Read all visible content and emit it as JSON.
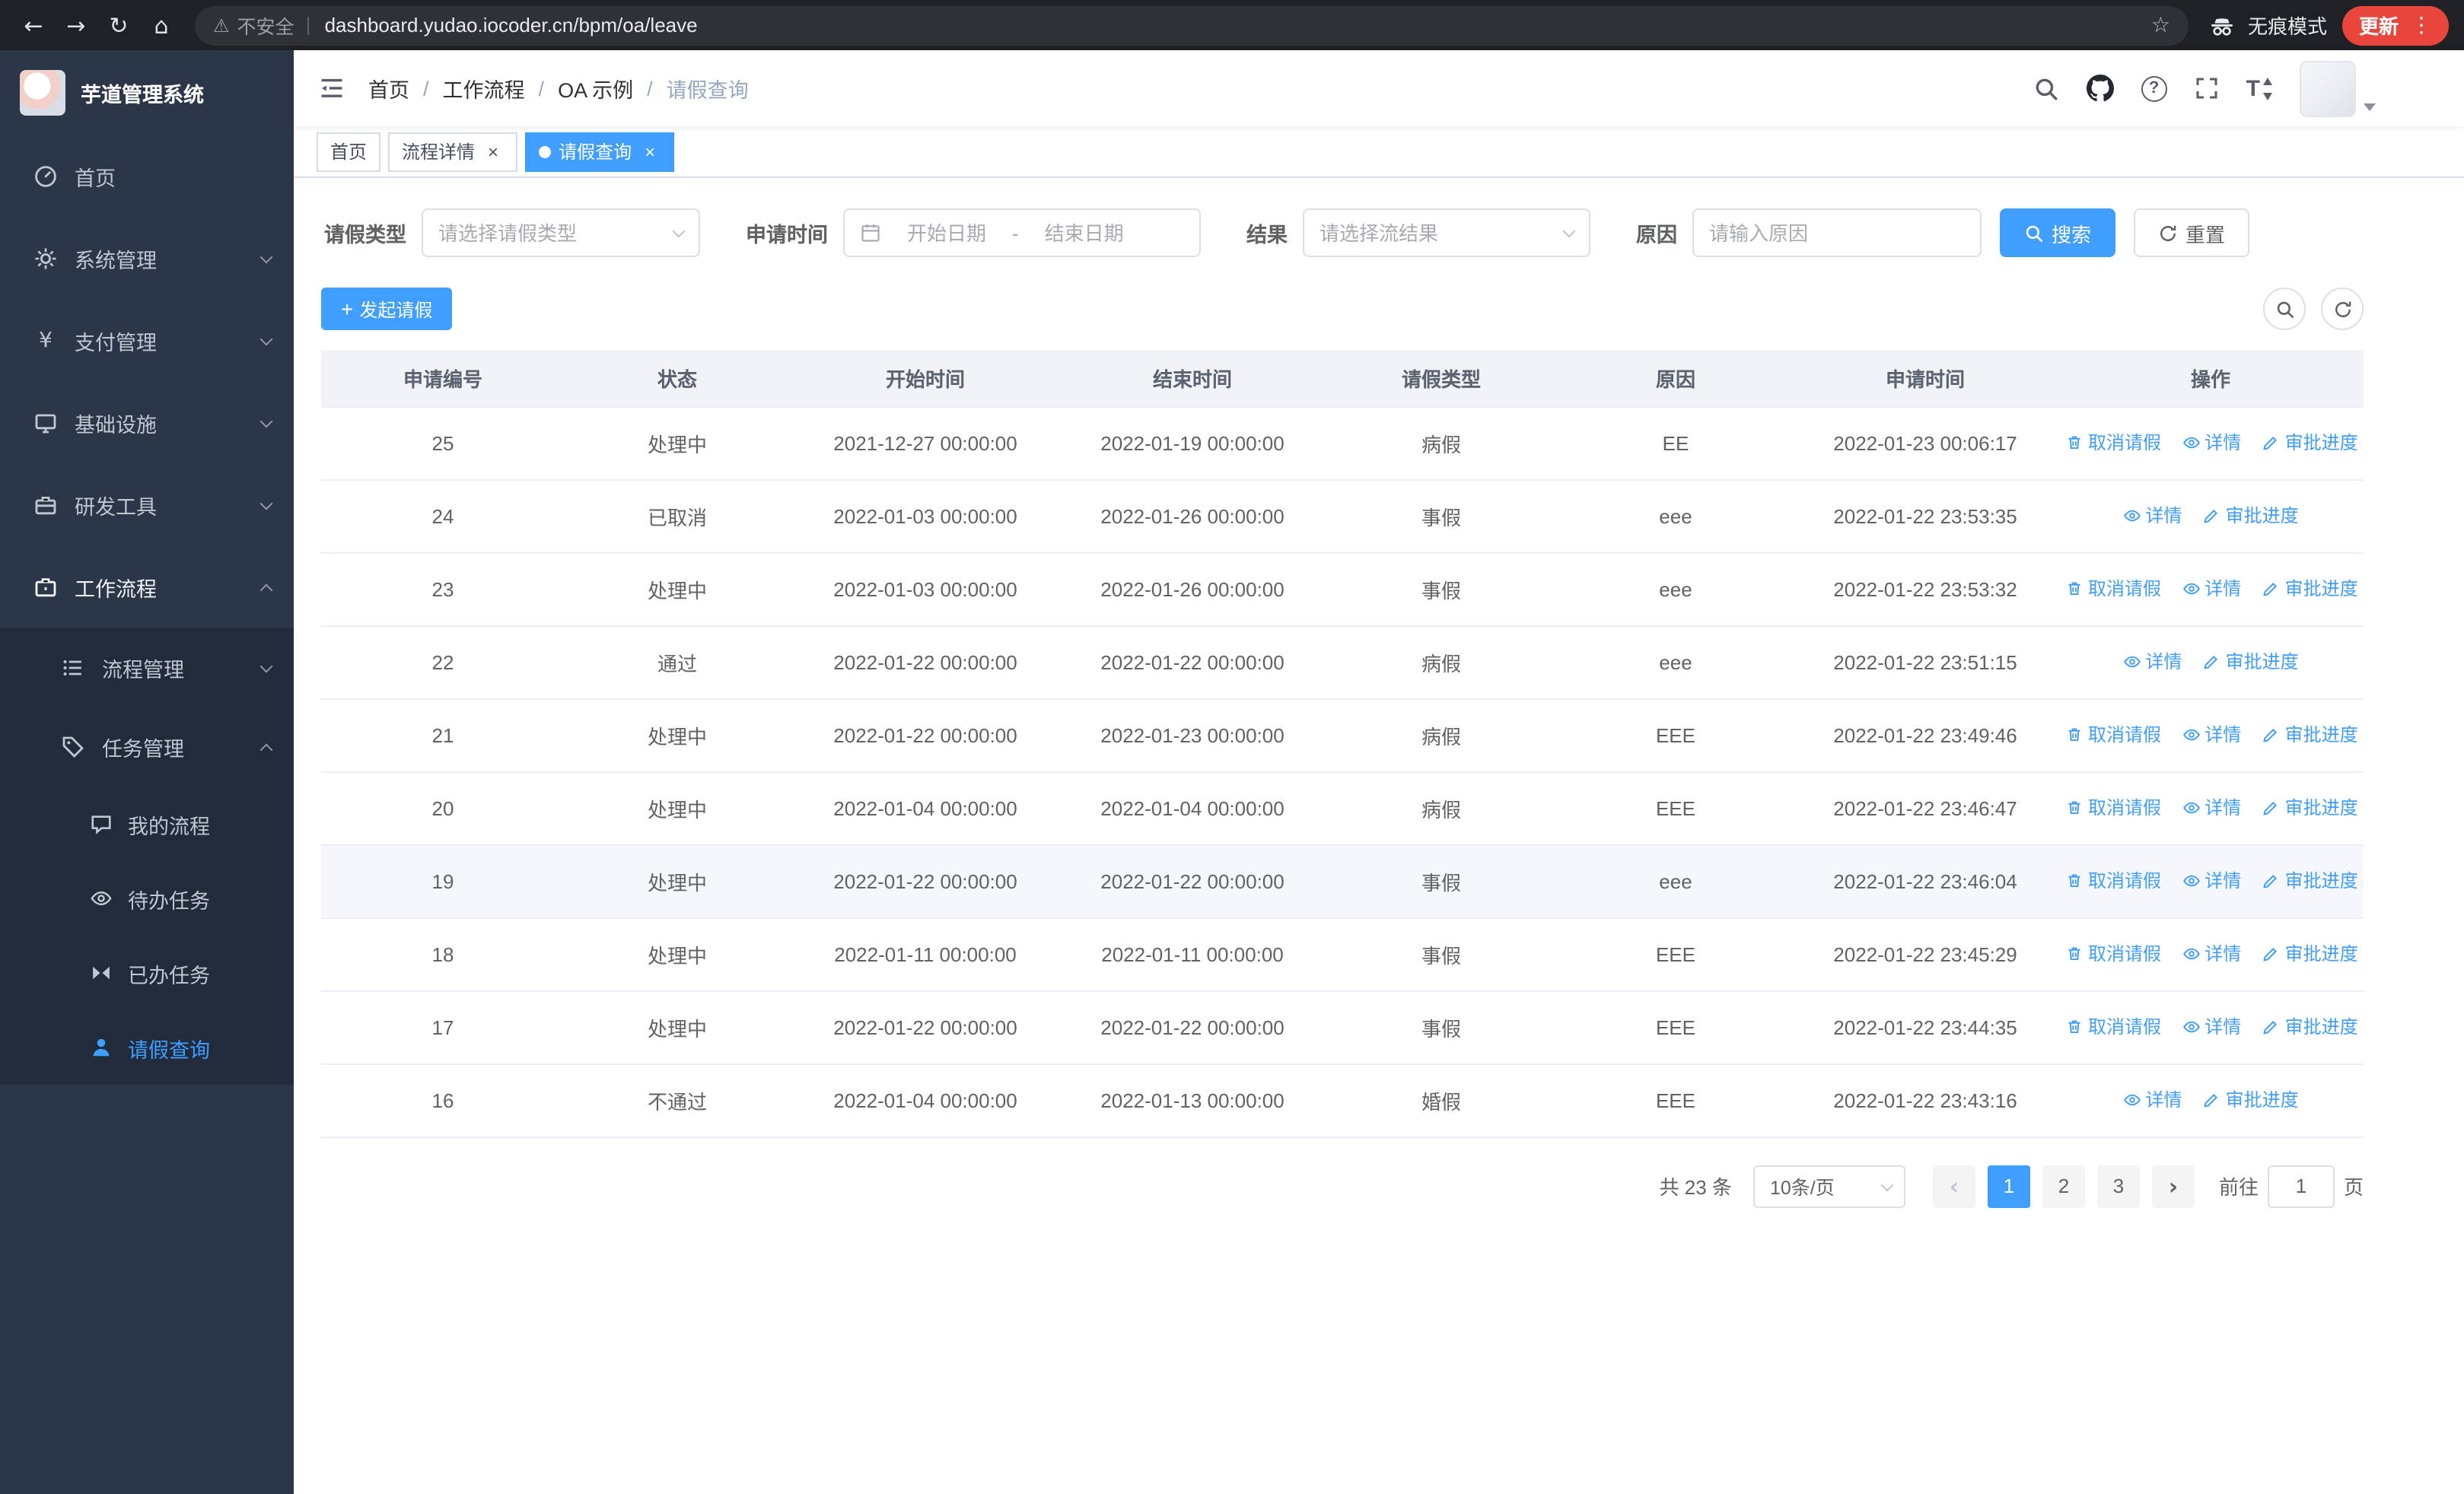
{
  "accent_color": "#409eff",
  "browser": {
    "security_label": "不安全",
    "url": "dashboard.yudao.iocoder.cn/bpm/oa/leave",
    "incognito_label": "无痕模式",
    "update_label": "更新"
  },
  "icons": {
    "back": "←",
    "forward": "→",
    "reload": "↻",
    "home": "⌂",
    "warning": "⚠",
    "star": "☆",
    "dots": "⋮",
    "close": "×",
    "plus": "+",
    "question": "?",
    "font_size": "T",
    "prev": "‹",
    "next": "›",
    "yen": "¥"
  },
  "sidebar": {
    "title": "芋道管理系统",
    "items": [
      {
        "label": "首页"
      },
      {
        "label": "系统管理"
      },
      {
        "label": "支付管理"
      },
      {
        "label": "基础设施"
      },
      {
        "label": "研发工具"
      },
      {
        "label": "工作流程"
      }
    ],
    "workflow_children": [
      {
        "label": "流程管理"
      },
      {
        "label": "任务管理"
      }
    ],
    "task_children": [
      {
        "label": "我的流程"
      },
      {
        "label": "待办任务"
      },
      {
        "label": "已办任务"
      },
      {
        "label": "请假查询"
      }
    ]
  },
  "header": {
    "breadcrumb": [
      {
        "label": "首页"
      },
      {
        "label": "工作流程"
      },
      {
        "label": "OA 示例"
      },
      {
        "label": "请假查询"
      }
    ],
    "breadcrumb_separator": "/"
  },
  "tabs": [
    {
      "label": "首页"
    },
    {
      "label": "流程详情"
    },
    {
      "label": "请假查询"
    }
  ],
  "filters": {
    "leave_type_label": "请假类型",
    "leave_type_placeholder": "请选择请假类型",
    "apply_time_label": "申请时间",
    "start_placeholder": "开始日期",
    "range_separator": "-",
    "end_placeholder": "结束日期",
    "result_label": "结果",
    "result_placeholder": "请选择流结果",
    "reason_label": "原因",
    "reason_placeholder": "请输入原因",
    "search_label": "搜索",
    "reset_label": "重置"
  },
  "toolbar": {
    "create_label": "发起请假"
  },
  "table": {
    "columns": [
      "申请编号",
      "状态",
      "开始时间",
      "结束时间",
      "请假类型",
      "原因",
      "申请时间",
      "操作"
    ],
    "action_labels": {
      "cancel": "取消请假",
      "detail": "详情",
      "progress": "审批进度"
    },
    "rows": [
      {
        "id": "25",
        "status": "处理中",
        "start": "2021-12-27 00:00:00",
        "end": "2022-01-19 00:00:00",
        "type": "病假",
        "reason": "EE",
        "applied": "2022-01-23 00:06:17"
      },
      {
        "id": "24",
        "status": "已取消",
        "start": "2022-01-03 00:00:00",
        "end": "2022-01-26 00:00:00",
        "type": "事假",
        "reason": "eee",
        "applied": "2022-01-22 23:53:35"
      },
      {
        "id": "23",
        "status": "处理中",
        "start": "2022-01-03 00:00:00",
        "end": "2022-01-26 00:00:00",
        "type": "事假",
        "reason": "eee",
        "applied": "2022-01-22 23:53:32"
      },
      {
        "id": "22",
        "status": "通过",
        "start": "2022-01-22 00:00:00",
        "end": "2022-01-22 00:00:00",
        "type": "病假",
        "reason": "eee",
        "applied": "2022-01-22 23:51:15"
      },
      {
        "id": "21",
        "status": "处理中",
        "start": "2022-01-22 00:00:00",
        "end": "2022-01-23 00:00:00",
        "type": "病假",
        "reason": "EEE",
        "applied": "2022-01-22 23:49:46"
      },
      {
        "id": "20",
        "status": "处理中",
        "start": "2022-01-04 00:00:00",
        "end": "2022-01-04 00:00:00",
        "type": "病假",
        "reason": "EEE",
        "applied": "2022-01-22 23:46:47"
      },
      {
        "id": "19",
        "status": "处理中",
        "start": "2022-01-22 00:00:00",
        "end": "2022-01-22 00:00:00",
        "type": "事假",
        "reason": "eee",
        "applied": "2022-01-22 23:46:04"
      },
      {
        "id": "18",
        "status": "处理中",
        "start": "2022-01-11 00:00:00",
        "end": "2022-01-11 00:00:00",
        "type": "事假",
        "reason": "EEE",
        "applied": "2022-01-22 23:45:29"
      },
      {
        "id": "17",
        "status": "处理中",
        "start": "2022-01-22 00:00:00",
        "end": "2022-01-22 00:00:00",
        "type": "事假",
        "reason": "EEE",
        "applied": "2022-01-22 23:44:35"
      },
      {
        "id": "16",
        "status": "不通过",
        "start": "2022-01-04 00:00:00",
        "end": "2022-01-13 00:00:00",
        "type": "婚假",
        "reason": "EEE",
        "applied": "2022-01-22 23:43:16"
      }
    ]
  },
  "pagination": {
    "total_label": "共 23 条",
    "page_size_label": "10条/页",
    "pages": [
      "1",
      "2",
      "3"
    ],
    "goto_label": "前往",
    "goto_value": "1",
    "page_unit_label": "页"
  }
}
